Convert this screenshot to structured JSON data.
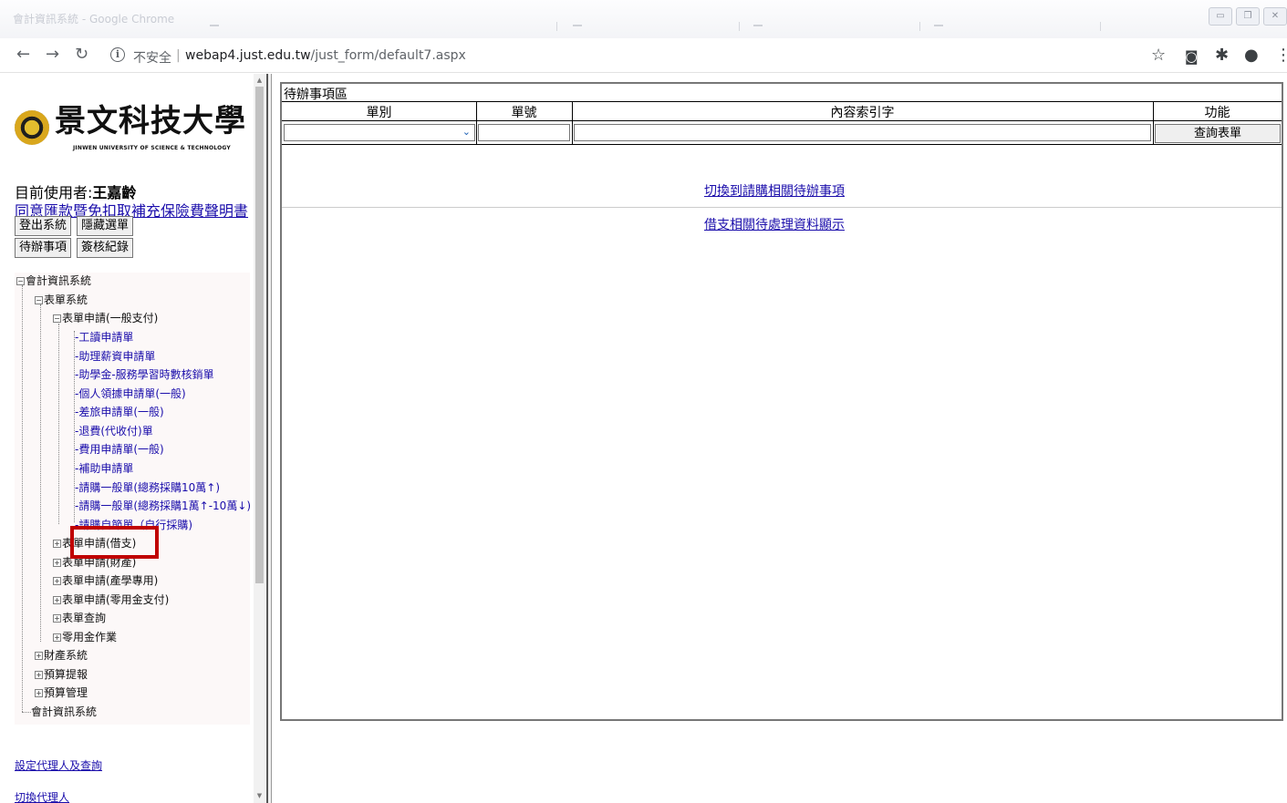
{
  "browser": {
    "window_title": "會計資訊系統 - Google Chrome",
    "insecure_label": "不安全",
    "url_host": "webap4.just.edu.tw",
    "url_path": "/just_form/default7.aspx"
  },
  "school": {
    "name": "景文科技大學",
    "name_en": "JINWEN UNIVERSITY OF SCIENCE & TECHNOLOGY"
  },
  "user": {
    "prefix": "目前使用者:",
    "name": "王嘉齡",
    "agreement_link": "同意匯款暨免扣取補充保險費聲明書"
  },
  "buttons": {
    "logout": "登出系統",
    "hide_menu": "隱藏選單",
    "todo": "待辦事項",
    "review_log": "簽核紀錄"
  },
  "tree": {
    "root": "會計資訊系統",
    "form_system": "表單系統",
    "general_payment": "表單申請(一般支付)",
    "leaves": [
      "工讀申請單",
      "助理薪資申請單",
      "助學金-服務學習時數核銷單",
      "個人領據申請單(一般)",
      "差旅申請單(一般)",
      "退費(代收付)單",
      "費用申請單(一般)",
      "補助申請單",
      "請購一般單(總務採購10萬↑)",
      "請購一般單(總務採購1萬↑-10萬↓)",
      "請購自節單（自行採購)"
    ],
    "subgroups": [
      "表單申請(借支)",
      "表單申請(財產)",
      "表單申請(產學專用)",
      "表單申請(零用金支付)",
      "表單查詢",
      "零用金作業"
    ],
    "top_groups": [
      "財產系統",
      "預算提報",
      "預算管理"
    ],
    "footer": "會計資訊系統"
  },
  "bottom_links": {
    "set_agent": "設定代理人及查詢",
    "switch_agent": "切換代理人"
  },
  "todo_panel": {
    "title": "待辦事項區",
    "headers": [
      "單別",
      "單號",
      "內容索引字",
      "功能"
    ],
    "form_type_value": "",
    "form_no_value": "",
    "keyword_value": "",
    "query_button": "查詢表單",
    "link_purchase": "切換到請購相關待辦事項",
    "link_advance": "借支相關待處理資料顯示"
  }
}
